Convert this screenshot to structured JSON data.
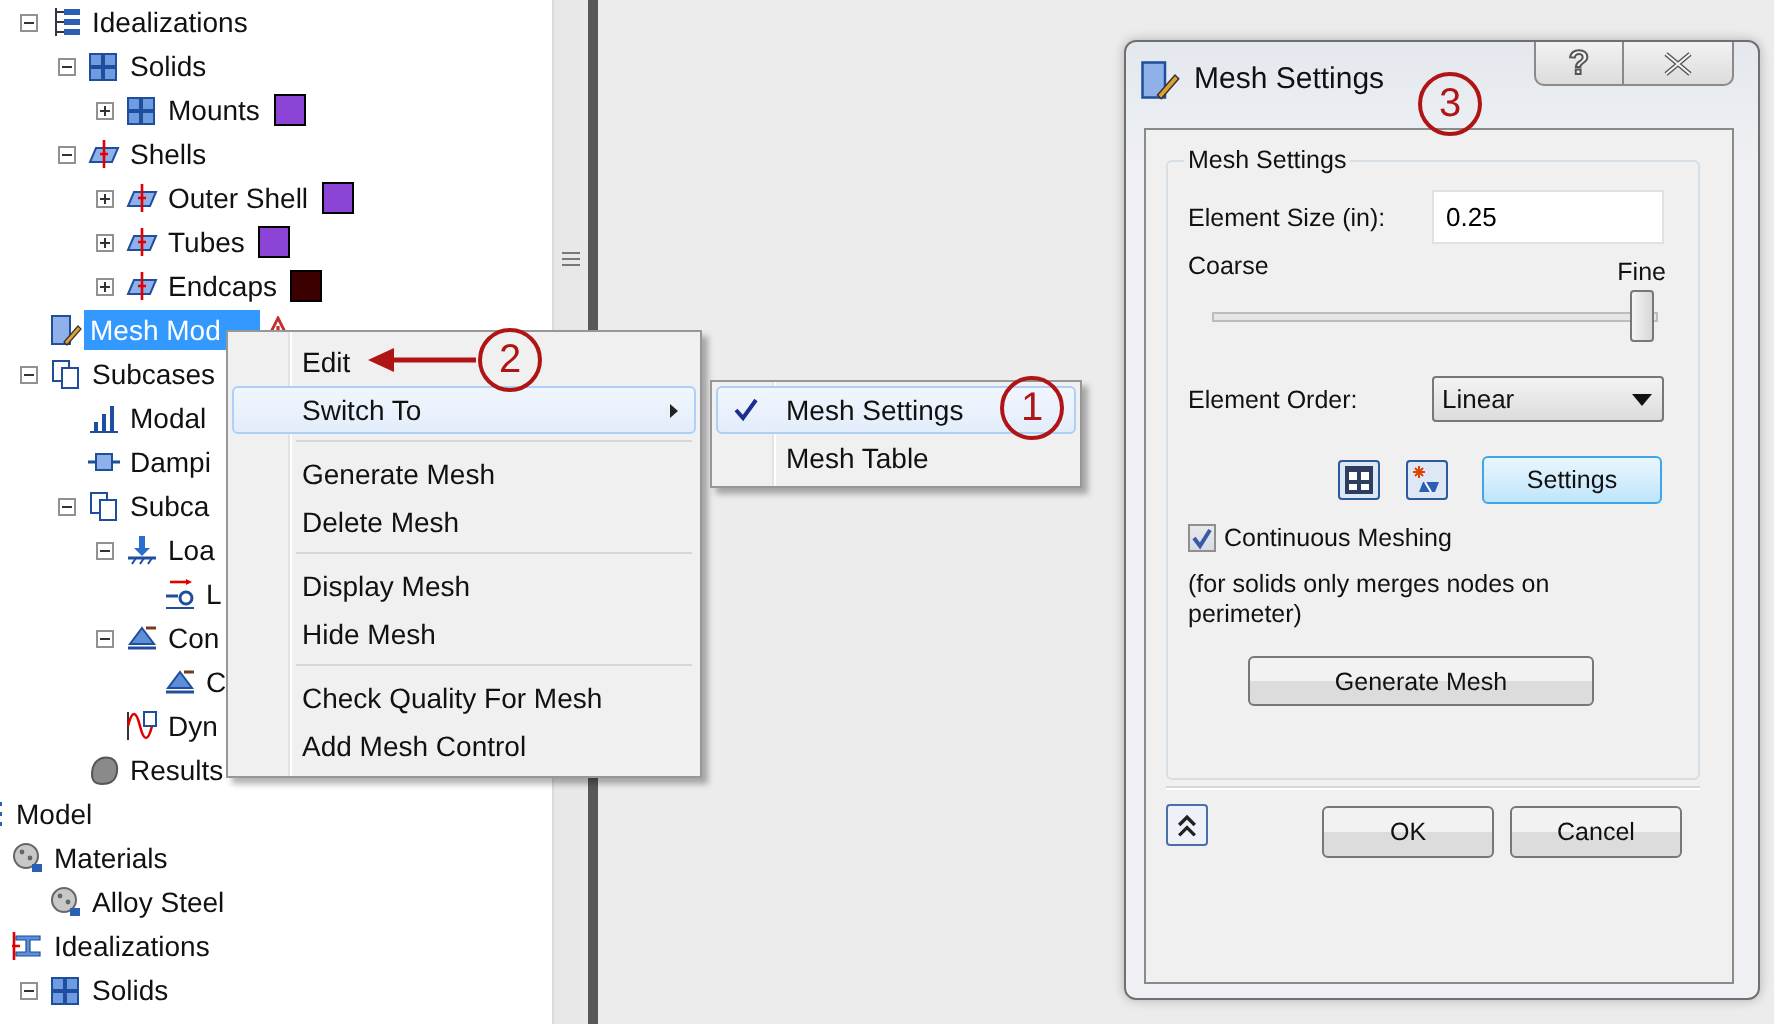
{
  "tree": {
    "continued": [
      {
        "label": "Idealizations",
        "kind": "hierarchy",
        "expanded": true,
        "selected": false,
        "children": [
          {
            "label": "Solids",
            "kind": "cubes",
            "expanded": true,
            "selected": false,
            "children": [
              {
                "label": "Mounts",
                "kind": "cubes",
                "expanded": false,
                "selected": false,
                "color": "#8b44d4"
              }
            ]
          },
          {
            "label": "Shells",
            "kind": "plate",
            "expanded": true,
            "selected": false,
            "children": [
              {
                "label": "Outer Shell",
                "kind": "plate",
                "expanded": false,
                "selected": false,
                "color": "#8b44d4"
              },
              {
                "label": "Tubes",
                "kind": "plate",
                "expanded": false,
                "selected": false,
                "color": "#8b44d4"
              },
              {
                "label": "Endcaps",
                "kind": "plate",
                "expanded": false,
                "selected": false,
                "color": "#3c0000"
              }
            ]
          }
        ]
      },
      {
        "label": "Mesh Mod",
        "kind": "mesh",
        "selected": true,
        "warning": true
      },
      {
        "label": "Subcases",
        "kind": "pages",
        "expanded": true,
        "selected": false,
        "children": [
          {
            "label": "Modal",
            "kind": "bars",
            "selected": false
          },
          {
            "label": "Dampi",
            "kind": "damper",
            "selected": false
          },
          {
            "label": "Subca",
            "kind": "pages",
            "expanded": true,
            "selected": false,
            "children": [
              {
                "label": "Loa",
                "kind": "load",
                "expanded": true,
                "selected": false,
                "children": [
                  {
                    "label": "L",
                    "kind": "load-arrow",
                    "selected": false
                  }
                ]
              },
              {
                "label": "Con",
                "kind": "support",
                "expanded": true,
                "selected": false,
                "children": [
                  {
                    "label": "C",
                    "kind": "support",
                    "selected": false
                  }
                ]
              },
              {
                "label": "Dyn",
                "kind": "wave",
                "selected": false
              }
            ]
          },
          {
            "label": "Results",
            "kind": "blob",
            "selected": false
          }
        ]
      }
    ],
    "items": [
      {
        "label": "Model",
        "kind": "list",
        "selected": false,
        "children": [
          {
            "label": "Materials",
            "kind": "globe",
            "selected": false,
            "children": [
              {
                "label": "Alloy Steel",
                "kind": "globe",
                "selected": false
              }
            ]
          },
          {
            "label": "Idealizations",
            "kind": "beam",
            "selected": false,
            "children": [
              {
                "label": "Solids",
                "kind": "cubes",
                "expanded": true,
                "selected": false
              }
            ]
          }
        ]
      }
    ]
  },
  "context_menu": {
    "items": [
      {
        "kind": "item",
        "label": "Edit",
        "highlighted": false
      },
      {
        "kind": "submenu",
        "label": "Switch To",
        "highlighted": true
      },
      {
        "kind": "separator"
      },
      {
        "kind": "item",
        "label": "Generate Mesh",
        "highlighted": false
      },
      {
        "kind": "item",
        "label": "Delete Mesh",
        "highlighted": false
      },
      {
        "kind": "separator"
      },
      {
        "kind": "item",
        "label": "Display Mesh",
        "highlighted": false
      },
      {
        "kind": "item",
        "label": "Hide Mesh",
        "highlighted": false
      },
      {
        "kind": "separator"
      },
      {
        "kind": "item",
        "label": "Check Quality For Mesh",
        "highlighted": false
      },
      {
        "kind": "item",
        "label": "Add Mesh Control",
        "highlighted": false
      }
    ]
  },
  "submenu": {
    "items": [
      {
        "label": "Mesh Settings",
        "checked": true,
        "highlighted": true
      },
      {
        "label": "Mesh Table",
        "checked": false,
        "highlighted": false
      }
    ]
  },
  "callouts": [
    {
      "number": "1",
      "arrow": false
    },
    {
      "number": "2",
      "arrow": true
    },
    {
      "number": "3",
      "arrow": false
    }
  ],
  "dialog": {
    "title": "Mesh Settings",
    "help_button": "?",
    "group_title": "Mesh Settings",
    "element_size": {
      "label": "Element Size (in):",
      "value": "0.25"
    },
    "slider": {
      "min_label": "Coarse",
      "max_label": "Fine",
      "level": 0.94
    },
    "element_order": {
      "label": "Element Order:",
      "value": "Linear"
    },
    "settings_button": "Settings",
    "continuous_meshing": {
      "label": "Continuous Meshing",
      "checked": true
    },
    "note": "(for solids only merges nodes on perimeter)",
    "generate_button": "Generate Mesh",
    "ok_button": "OK",
    "cancel_button": "Cancel"
  }
}
